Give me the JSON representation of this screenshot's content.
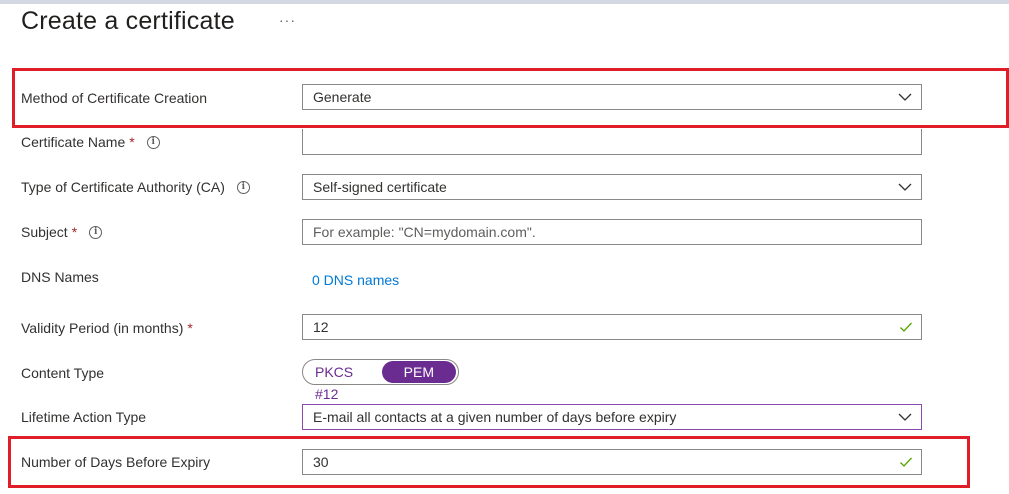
{
  "page": {
    "title": "Create a certificate",
    "more": "···"
  },
  "form": {
    "method": {
      "label": "Method of Certificate Creation",
      "value": "Generate"
    },
    "cert_name": {
      "label": "Certificate Name",
      "required": "*",
      "value": ""
    },
    "ca_type": {
      "label": "Type of Certificate Authority (CA)",
      "value": "Self-signed certificate"
    },
    "subject": {
      "label": "Subject",
      "required": "*",
      "placeholder": "For example: \"CN=mydomain.com\"."
    },
    "dns": {
      "label": "DNS Names",
      "link": "0 DNS names"
    },
    "validity": {
      "label": "Validity Period (in months)",
      "required": "*",
      "value": "12"
    },
    "content_type": {
      "label": "Content Type",
      "options": [
        "PKCS #12",
        "PEM"
      ],
      "selected": "PEM"
    },
    "lifetime": {
      "label": "Lifetime Action Type",
      "value": "E-mail all contacts at a given number of days before expiry"
    },
    "days_before_expiry": {
      "label": "Number of Days Before Expiry",
      "value": "30"
    }
  },
  "colors": {
    "highlight": "#e01e2a",
    "accent": "#6b2c91",
    "link": "#0078d4",
    "valid": "#57a300"
  }
}
